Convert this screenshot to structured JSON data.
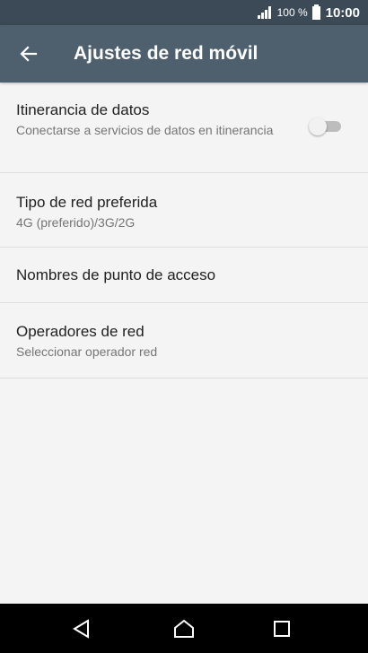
{
  "status_bar": {
    "battery_percent": "100 %",
    "time": "10:00",
    "signal_icon": "signal-icon",
    "battery_icon": "battery-icon"
  },
  "app_bar": {
    "title": "Ajustes de red móvil",
    "back_icon": "arrow-back-icon"
  },
  "items": [
    {
      "title": "Itinerancia de datos",
      "subtitle": "Conectarse a servicios de datos en itinerancia",
      "toggle_on": false
    },
    {
      "title": "Tipo de red preferida",
      "subtitle": "4G (preferido)/3G/2G"
    },
    {
      "title": "Nombres de punto de acceso"
    },
    {
      "title": "Operadores de red",
      "subtitle": "Seleccionar operador red"
    }
  ],
  "nav_bar": {
    "back_icon": "nav-back-icon",
    "home_icon": "nav-home-icon",
    "recents_icon": "nav-recents-icon"
  },
  "colors": {
    "status_bar": "#3b4a56",
    "app_bar": "#4e606d",
    "background": "#f4f4f4",
    "toggle_off": "#bdbdbd"
  }
}
